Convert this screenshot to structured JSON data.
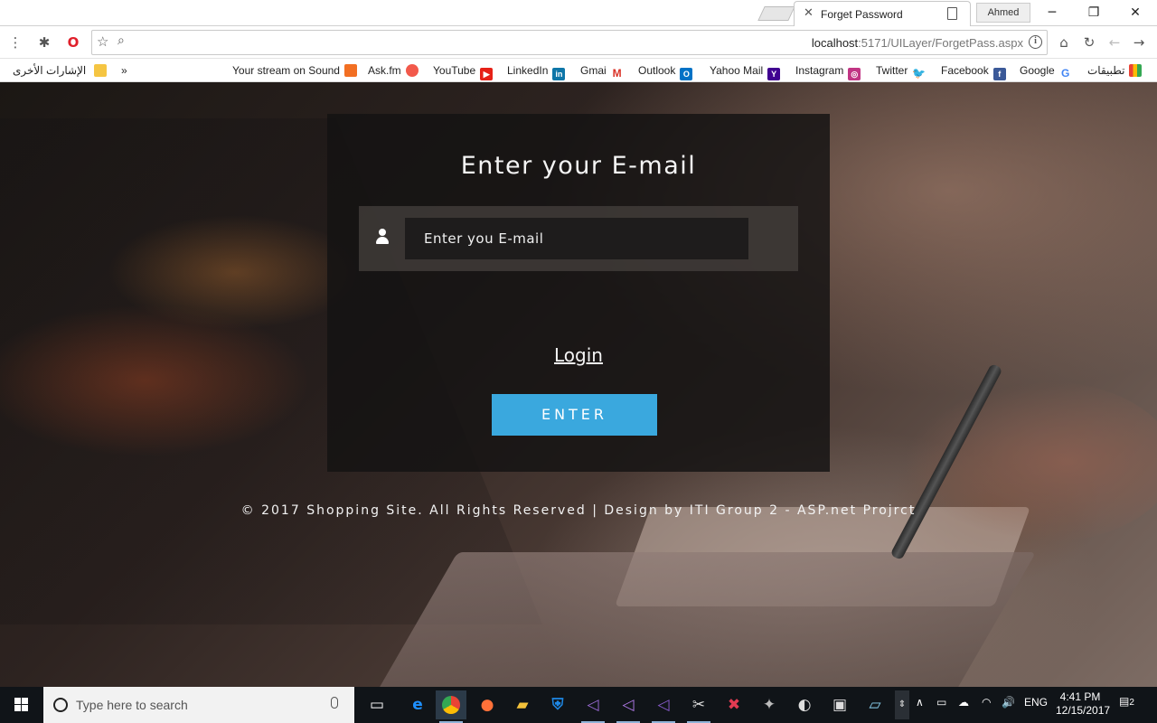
{
  "browser": {
    "tab_title": "Forget Password",
    "profile_name": "Ahmed",
    "url_host": "localhost",
    "url_path": ":5171/UILayer/ForgetPass.aspx"
  },
  "bookmarks": {
    "other_bookmarks_label": "الإشارات الأخرى",
    "overflow": "»",
    "items": [
      {
        "label": "Your stream on Sound",
        "icon": "soundcloud-icon",
        "color": "#f26f23"
      },
      {
        "label": "Ask.fm",
        "icon": "askfm-icon",
        "color": "#f2594b"
      },
      {
        "label": "YouTube",
        "icon": "youtube-icon",
        "color": "#e62117"
      },
      {
        "label": "LinkedIn",
        "icon": "linkedin-icon",
        "color": "#0e76a8"
      },
      {
        "label": "Gmai",
        "icon": "gmail-icon",
        "color": "#d93025"
      },
      {
        "label": "Outlook",
        "icon": "outlook-icon",
        "color": "#0072c6"
      },
      {
        "label": "Yahoo Mail",
        "icon": "yahoo-icon",
        "color": "#400191"
      },
      {
        "label": "Instagram",
        "icon": "instagram-icon",
        "color": "#c13584"
      },
      {
        "label": "Twitter",
        "icon": "twitter-icon",
        "color": "#1da1f2"
      },
      {
        "label": "Facebook",
        "icon": "facebook-icon",
        "color": "#3b5998"
      },
      {
        "label": "Google",
        "icon": "google-icon",
        "color": "#4285f4"
      }
    ],
    "apps_label": "تطبيقات"
  },
  "page": {
    "form_title": "Enter your E-mail",
    "email_placeholder": "Enter you E-mail",
    "login_link": "Login",
    "enter_button": "ENTER",
    "footer": "© 2017 Shopping Site. All Rights Reserved | Design by ITI Group 2 - ASP.net Projrct",
    "accent_color": "#3aa8de"
  },
  "taskbar": {
    "search_placeholder": "Type here to search",
    "language": "ENG",
    "time": "4:41 PM",
    "date": "12/15/2017",
    "notification_count": "2"
  }
}
